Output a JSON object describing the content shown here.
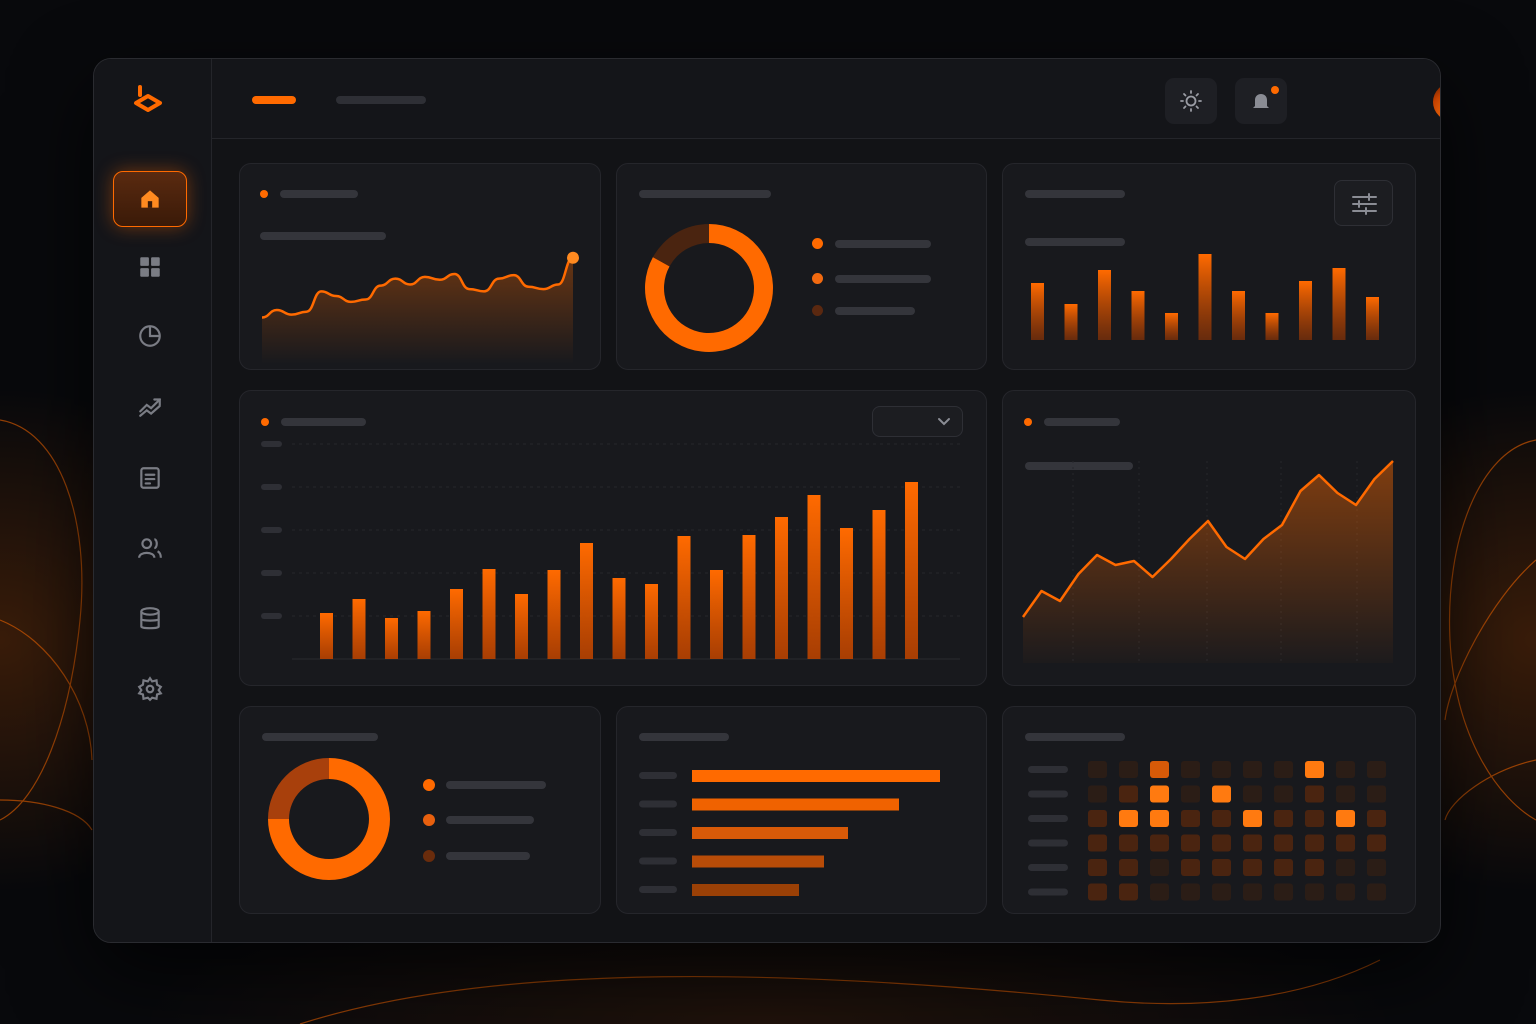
{
  "app": {
    "accent": "#ff6a00",
    "logo_icon": "hexagon-logo"
  },
  "sidebar": {
    "items": [
      {
        "icon": "home-icon",
        "active": true
      },
      {
        "icon": "grid-icon",
        "active": false
      },
      {
        "icon": "pie-chart-icon",
        "active": false
      },
      {
        "icon": "trend-icon",
        "active": false
      },
      {
        "icon": "document-icon",
        "active": false
      },
      {
        "icon": "users-icon",
        "active": false
      },
      {
        "icon": "database-icon",
        "active": false
      },
      {
        "icon": "gear-icon",
        "active": false
      }
    ]
  },
  "topbar": {
    "icons": [
      "sun-icon",
      "bell-icon",
      "avatar",
      "chevron-down-icon"
    ],
    "notification": true
  },
  "chart_data": [
    {
      "type": "line",
      "y": [
        0.25,
        0.38,
        0.3,
        0.35,
        0.7,
        0.62,
        0.52,
        0.56,
        0.8,
        0.92,
        0.82,
        0.95,
        0.9,
        1.0,
        0.74,
        0.7,
        0.92,
        0.98,
        0.78,
        0.74,
        0.82,
        1.28
      ]
    },
    {
      "type": "pie",
      "values": [
        0.83,
        0.17
      ]
    },
    {
      "type": "bar",
      "values": [
        57,
        36,
        70,
        49,
        27,
        86,
        49,
        27,
        59,
        72,
        43
      ]
    },
    {
      "type": "bar",
      "values": [
        46,
        60,
        41,
        48,
        70,
        90,
        65,
        89,
        116,
        81,
        75,
        123,
        89,
        124,
        142,
        164,
        131,
        149,
        177
      ]
    },
    {
      "type": "area",
      "y": [
        12,
        38,
        28,
        55,
        74,
        64,
        68,
        52,
        70,
        90,
        108,
        82,
        70,
        90,
        104,
        138,
        154,
        136,
        124,
        150,
        168
      ]
    },
    {
      "type": "pie",
      "values": [
        0.75,
        0.25
      ]
    },
    {
      "type": "bar",
      "values": [
        248,
        207,
        156,
        132,
        107
      ]
    },
    {
      "type": "heatmap",
      "rows": 6,
      "cols": 10,
      "values": [
        [
          1,
          1,
          3,
          1,
          1,
          1,
          1,
          4,
          1,
          1
        ],
        [
          1,
          2,
          4,
          1,
          4,
          1,
          1,
          2,
          1,
          1
        ],
        [
          2,
          4,
          4,
          2,
          2,
          4,
          2,
          2,
          4,
          2
        ],
        [
          2,
          2,
          2,
          2,
          2,
          2,
          2,
          2,
          2,
          2
        ],
        [
          2,
          2,
          1,
          2,
          2,
          2,
          2,
          2,
          1,
          1
        ],
        [
          2,
          2,
          1,
          1,
          1,
          1,
          1,
          1,
          1,
          1
        ]
      ]
    }
  ]
}
